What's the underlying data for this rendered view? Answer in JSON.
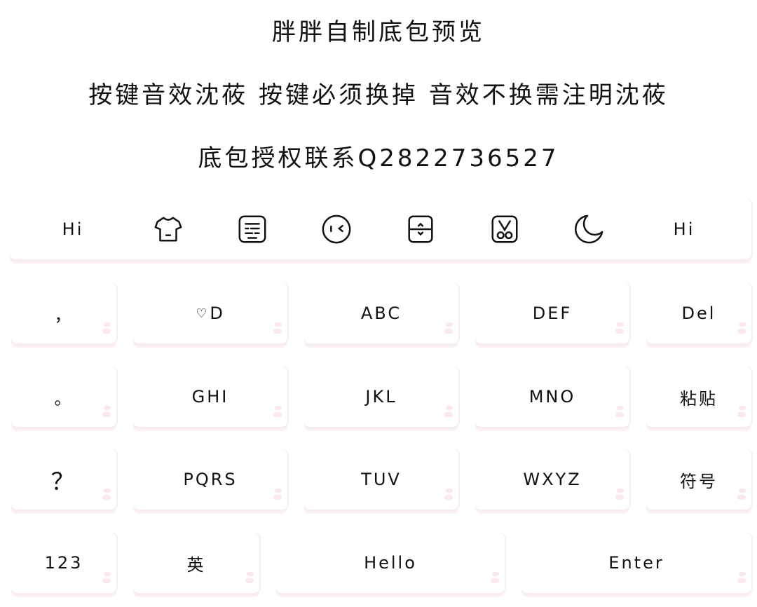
{
  "header": {
    "title": "胖胖自制底包预览",
    "notice": "按键音效沈莜 按键必须换掉 音效不换需注明沈莜",
    "contact": "底包授权联系Q2822736527"
  },
  "toolbar": {
    "left_label": "Hi",
    "right_label": "Hi",
    "icons": [
      "shirt-icon",
      "keyboard-icon",
      "emoji-face-icon",
      "cursor-move-icon",
      "clipboard-icon",
      "moon-icon"
    ]
  },
  "keys": {
    "row1": [
      "，",
      "D",
      "ABC",
      "DEF",
      "Del"
    ],
    "row1_heart": "♡",
    "row2": [
      "。",
      "GHI",
      "JKL",
      "MNO",
      "粘贴"
    ],
    "row3": [
      "？",
      "PQRS",
      "TUV",
      "WXYZ",
      "符号"
    ],
    "row4": [
      "123",
      "英",
      "Hello",
      "Enter"
    ]
  },
  "colors": {
    "key_shadow": "#f8ecef",
    "key_dot": "#fbe7ec",
    "text": "#111111"
  }
}
